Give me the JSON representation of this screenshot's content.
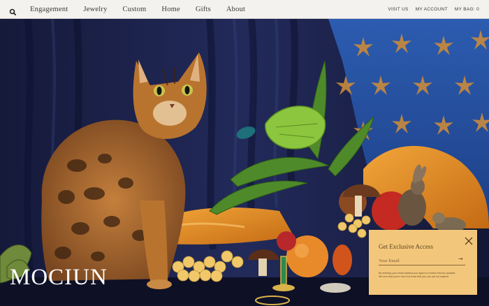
{
  "header": {
    "nav": [
      {
        "label": "Engagement"
      },
      {
        "label": "Jewelry"
      },
      {
        "label": "Custom"
      },
      {
        "label": "Home"
      },
      {
        "label": "Gifts"
      },
      {
        "label": "About"
      }
    ],
    "utility": {
      "visit_us": "VISIT US",
      "my_account": "MY ACCOUNT",
      "my_bag": "MY BAG: 0"
    },
    "search_icon": "search-icon"
  },
  "hero": {
    "brand": "MOCIUN",
    "image_subject": "bengal cat beside fruit, flowers and jewelry still life"
  },
  "popup": {
    "title": "Get Exclusive Access",
    "email_placeholder": "Your Email",
    "submit_icon": "arrow-right",
    "fine_print_1": "By entering your email address you agree to receive Mociun updates.",
    "fine_print_2": "We love that you're here but know that you can opt out anytime.",
    "close_icon": "close-icon"
  },
  "colors": {
    "nav_bg": "#f3f2ef",
    "curtain": "#1f2550",
    "wall_blue": "#2b57a6",
    "starfish": "#c98a3c",
    "silk": "#e8922a",
    "popup_bg": "#f3c77b"
  }
}
